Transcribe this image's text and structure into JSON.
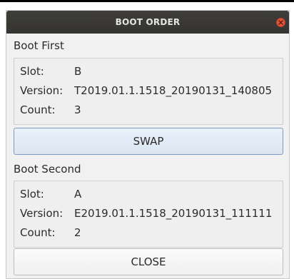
{
  "window": {
    "title": "BOOT ORDER"
  },
  "boot_first": {
    "heading": "Boot First",
    "slot_label": "Slot:",
    "slot_value": "B",
    "version_label": "Version:",
    "version_value": "T2019.01.1.1518_20190131_140805",
    "count_label": "Count:",
    "count_value": "3"
  },
  "swap_button": {
    "label": "SWAP"
  },
  "boot_second": {
    "heading": "Boot Second",
    "slot_label": "Slot:",
    "slot_value": "A",
    "version_label": "Version:",
    "version_value": "E2019.01.1.1518_20190131_111111",
    "count_label": "Count:",
    "count_value": "2"
  },
  "close_button": {
    "label": "CLOSE"
  },
  "colors": {
    "titlebar": "#3a3935",
    "close_icon": "#e2553b",
    "swap_border": "#7d9cc0"
  },
  "icons": {
    "window_close": "close-icon"
  }
}
